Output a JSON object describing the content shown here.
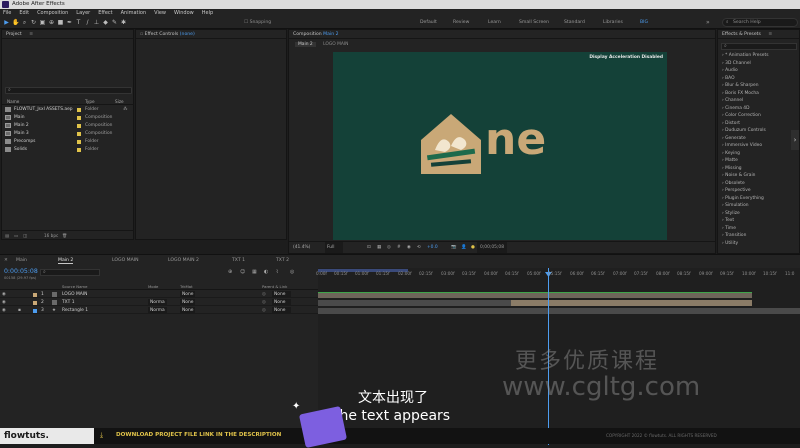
{
  "window": {
    "title": "Adobe After Effects"
  },
  "menu": [
    "File",
    "Edit",
    "Composition",
    "Layer",
    "Effect",
    "Animation",
    "View",
    "Window",
    "Help"
  ],
  "toolbar": {
    "snapping": "Snapping",
    "workspaces": [
      "Default",
      "Review",
      "Learn",
      "Small Screen",
      "Standard",
      "Libraries",
      "BIG"
    ],
    "active_workspace": "BIG",
    "search_placeholder": "Search Help"
  },
  "project_panel": {
    "title": "Project",
    "headers": {
      "name": "Name",
      "type": "Type",
      "size": "Size"
    },
    "items": [
      {
        "name": "FLOWTUT_Jsxl ASSETS.aep",
        "type": "Folder",
        "color": "#e0c34a"
      },
      {
        "name": "Main",
        "type": "Composition",
        "color": "#e0c34a"
      },
      {
        "name": "Main 2",
        "type": "Composition",
        "color": "#e0c34a"
      },
      {
        "name": "Main 3",
        "type": "Composition",
        "color": "#e0c34a"
      },
      {
        "name": "Precomps",
        "type": "Folder",
        "color": "#e0c34a"
      },
      {
        "name": "Solids",
        "type": "Folder",
        "color": "#e0c34a"
      }
    ],
    "bpc": "16 bpc"
  },
  "effect_controls": {
    "title": "Effect Controls",
    "target": "(none)"
  },
  "composition": {
    "title": "Composition",
    "comp_name": "Main 2",
    "breadcrumbs": [
      "Main 2",
      "LOGO MAIN"
    ],
    "notice": "Display Acceleration Disabled",
    "logo_text": "ne",
    "bg_color": "#144138",
    "logo_color": "#c9a877",
    "zoom": "(41.4%)",
    "quality": "Full",
    "exposure": "+0.0",
    "timecode": "0;00;05;08"
  },
  "effects_presets": {
    "title": "Effects & Presets",
    "items": [
      "* Animation Presets",
      "3D Channel",
      "Audio",
      "BAO",
      "Blur & Sharpen",
      "Boris FX Mocha",
      "Channel",
      "Cinema 4D",
      "Color Correction",
      "Distort",
      "Duduzum Controls",
      "Generate",
      "Immersive Video",
      "Keying",
      "Matte",
      "Missing",
      "Noise & Grain",
      "Obsolete",
      "Perspective",
      "Plugin Everything",
      "Simulation",
      "Stylize",
      "Text",
      "Time",
      "Transition",
      "Utility"
    ]
  },
  "timeline": {
    "tabs": [
      "Main",
      "Main 2",
      "LOGO MAIN",
      "LOGO MAIN 2",
      "TXT 1",
      "TXT 2"
    ],
    "active_tab": "Main 2",
    "timecode": "0:00:05:08",
    "fps_note": "00158 (29.97 fps)",
    "columns": {
      "source": "Source Name",
      "mode": "Mode",
      "trkmat": "TrkMat",
      "parent": "Parent & Link"
    },
    "layers": [
      {
        "num": "1",
        "name": "LOGO MAIN",
        "mode": "",
        "parent": "None"
      },
      {
        "num": "2",
        "name": "TXT 1",
        "mode": "Norma",
        "parent": "None"
      },
      {
        "num": "3",
        "name": "Rectangle 1",
        "mode": "Norma",
        "parent": "None"
      }
    ],
    "ruler": [
      "0:00f",
      "00:15f",
      "01:00f",
      "01:15f",
      "02:00f",
      "02:15f",
      "03:00f",
      "03:15f",
      "04:00f",
      "04:15f",
      "05:00f",
      "05:15f",
      "06:00f",
      "06:15f",
      "07:00f",
      "07:15f",
      "08:00f",
      "08:15f",
      "09:00f",
      "09:15f",
      "10:00f",
      "10:15f",
      "11:0"
    ]
  },
  "subtitle": {
    "cn": "文本出现了",
    "en": "the text appears"
  },
  "watermark": {
    "cn": "更多优质课程",
    "url": "www.cgltg.com"
  },
  "footer": {
    "brand": "flowtuts.",
    "download": "DOWNLOAD PROJECT FILE LINK IN THE DESCRIPTION",
    "copyright": "COPYRIGHT 2022 © flowtuts. ALL RIGHTS RESERVED"
  }
}
